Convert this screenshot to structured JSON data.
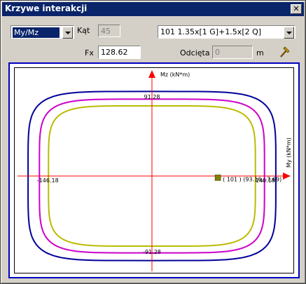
{
  "window": {
    "title": "Krzywe interakcji",
    "close_glyph": "✕"
  },
  "toolbar": {
    "plane_select": {
      "value": "My/Mz"
    },
    "angle": {
      "label": "Kąt",
      "value": "45"
    },
    "combination_select": {
      "value": "101 1.35x[1 G]+1.5x[2 Q]"
    },
    "fx": {
      "label": "Fx",
      "value": "128.62"
    },
    "offset": {
      "label": "Odcięta",
      "value": "0",
      "unit": "m"
    },
    "tool_icon": "hammer-icon"
  },
  "chart_data": {
    "type": "scatter",
    "xlabel": "My (kN*m)",
    "ylabel": "Mz (kN*m)",
    "x_tick_labels": {
      "left": "-146.18",
      "right": "146.18"
    },
    "y_tick_labels": {
      "top": "91.28",
      "bottom": "-91.28"
    },
    "xlim": [
      -185,
      185
    ],
    "ylim": [
      -125,
      125
    ],
    "curves": [
      {
        "color": "#000099",
        "extent_x": 175,
        "extent_y": 110
      },
      {
        "color": "#cc00cc",
        "extent_x": 159,
        "extent_y": 100
      },
      {
        "color": "#bbbb00",
        "extent_x": 146.18,
        "extent_y": 91.28
      }
    ],
    "point": {
      "x": 93.16,
      "y": -7.69,
      "label": "( 101 ) (93.16, -7.69)",
      "color": "#808000"
    },
    "axis_color": "#ff0000"
  }
}
